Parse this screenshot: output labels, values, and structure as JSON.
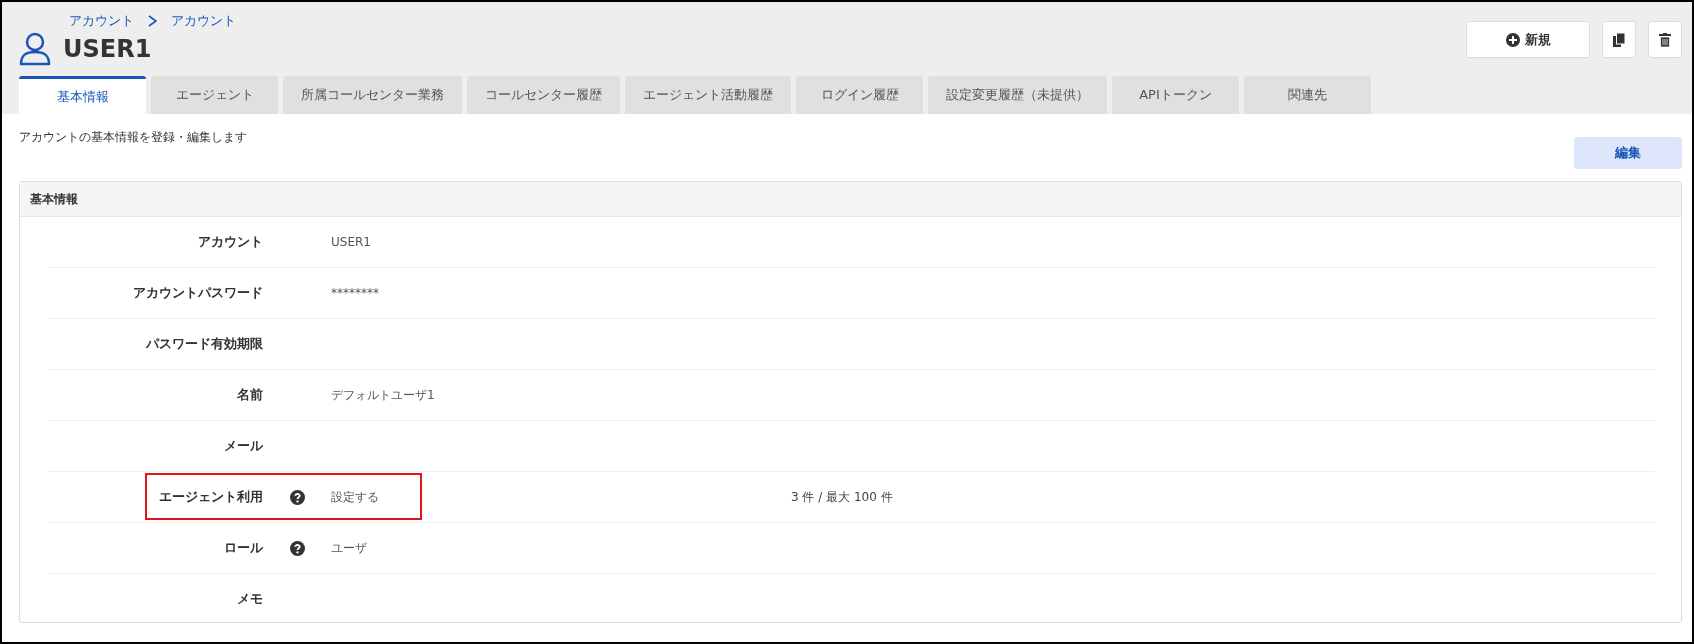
{
  "breadcrumb": [
    "アカウント",
    "アカウント"
  ],
  "title": "USER1",
  "actions": {
    "new_label": "新規"
  },
  "tabs": [
    {
      "label": "基本情報",
      "selected": true
    },
    {
      "label": "エージェント",
      "selected": false
    },
    {
      "label": "所属コールセンター業務",
      "selected": false
    },
    {
      "label": "コールセンター履歴",
      "selected": false
    },
    {
      "label": "エージェント活動履歴",
      "selected": false
    },
    {
      "label": "ログイン履歴",
      "selected": false
    },
    {
      "label": "設定変更履歴（未提供）",
      "selected": false
    },
    {
      "label": "APIトークン",
      "selected": false
    },
    {
      "label": "関連先",
      "selected": false
    }
  ],
  "description": "アカウントの基本情報を登録・編集します",
  "edit_button": "編集",
  "panel": {
    "title": "基本情報",
    "rows": [
      {
        "label": "アカウント",
        "help": false,
        "value": "USER1",
        "highlighted": false
      },
      {
        "label": "アカウントパスワード",
        "help": false,
        "value": "********",
        "highlighted": false
      },
      {
        "label": "パスワード有効期限",
        "help": false,
        "highlighted": false
      },
      {
        "label": "名前",
        "help": false,
        "value": "デフォルトユーザ1",
        "highlighted": false
      },
      {
        "label": "メール",
        "help": false,
        "highlighted": false
      },
      {
        "label": "エージェント利用",
        "help": true,
        "value": "設定する",
        "extra": "3 件 / 最大 100 件",
        "highlighted": true
      },
      {
        "label": "ロール",
        "help": true,
        "value": "ユーザ",
        "highlighted": false
      },
      {
        "label": "メモ",
        "help": false,
        "highlighted": false
      }
    ]
  }
}
